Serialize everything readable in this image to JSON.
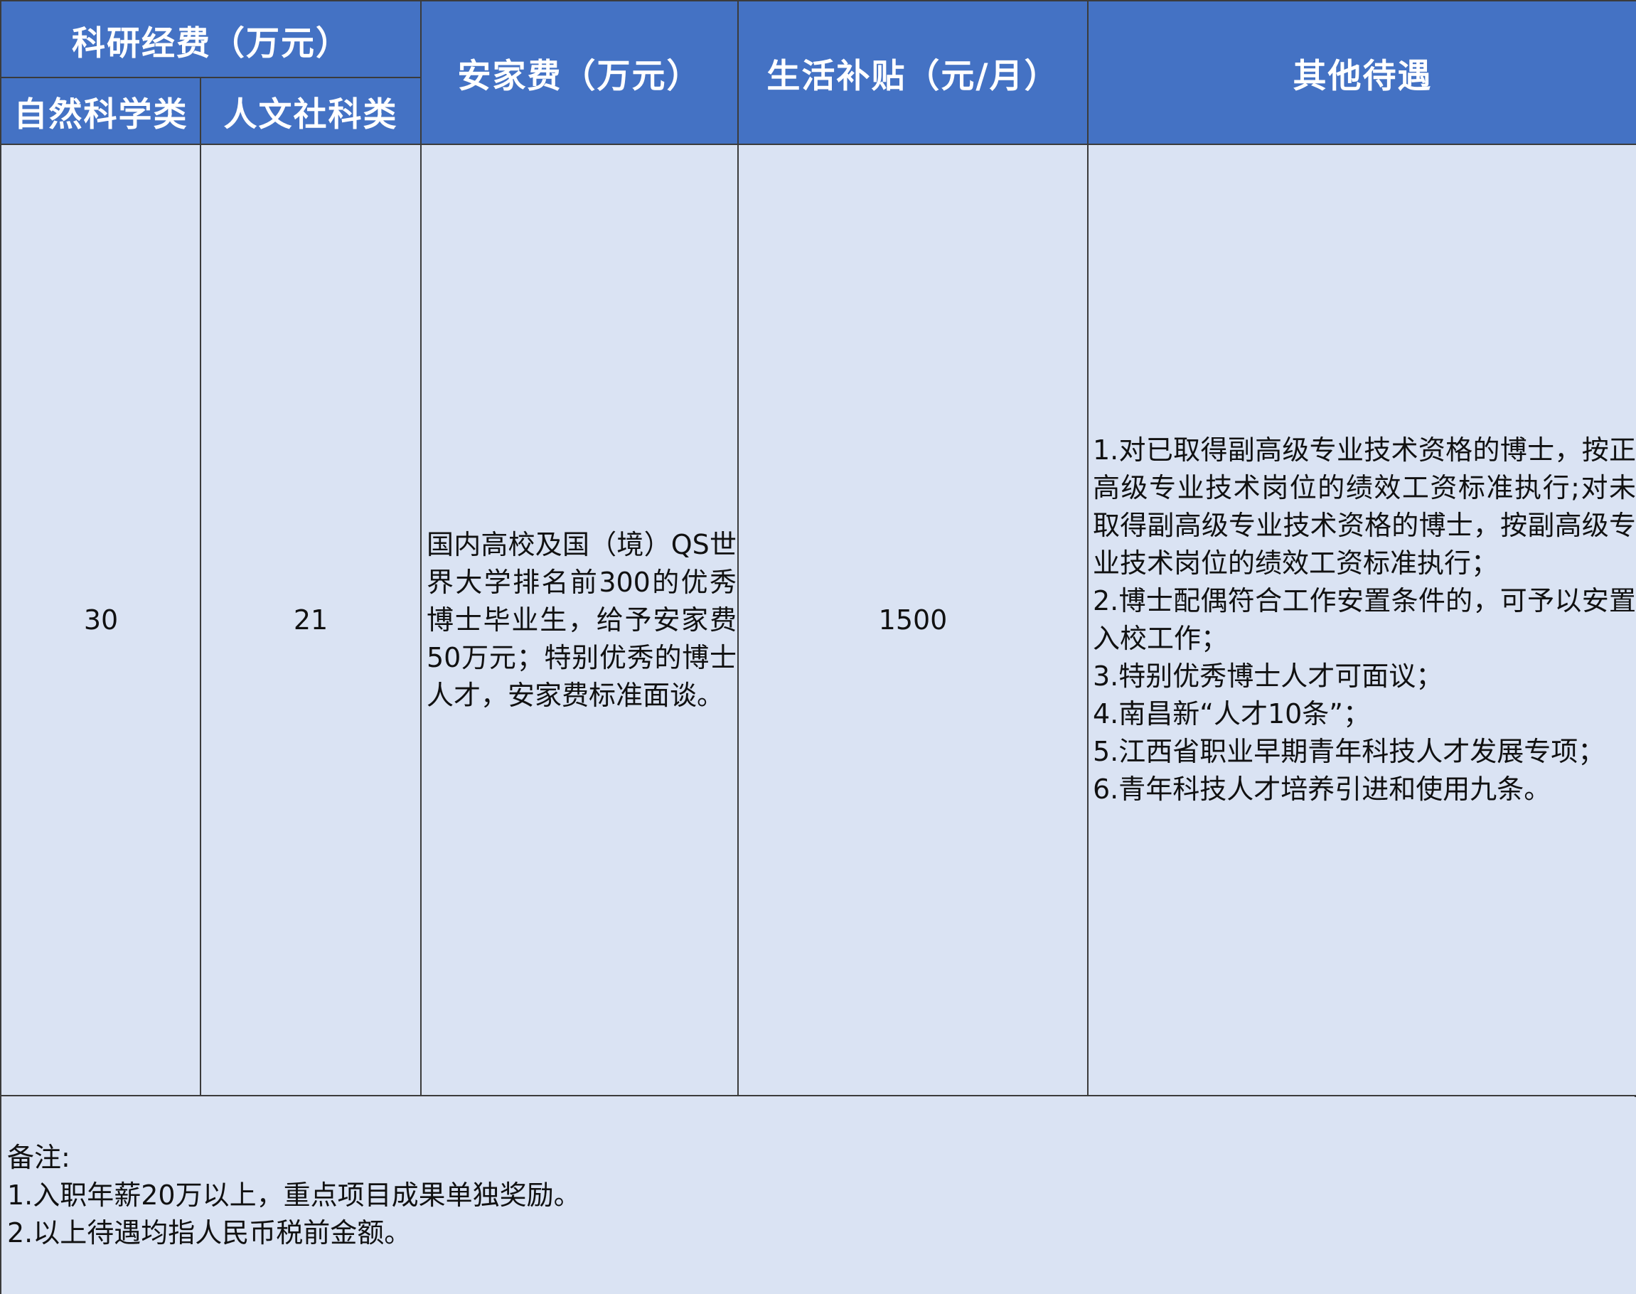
{
  "table": {
    "headers": {
      "research_fund": "科研经费（万元）",
      "natural_science": "自然科学类",
      "humanities_social": "人文社科类",
      "settlement_fee": "安家费（万元）",
      "living_allowance": "生活补贴（元/月）",
      "other_benefits": "其他待遇"
    },
    "row": {
      "natural_science": "30",
      "humanities_social": "21",
      "settlement_fee": "国内高校及国（境）QS世界大学排名前300的优秀博士毕业生，给予安家费50万元；特别优秀的博士人才，安家费标准面谈。",
      "living_allowance": "1500",
      "other_benefits": [
        "1.对已取得副高级专业技术资格的博士，按正高级专业技术岗位的绩效工资标准执行;对未取得副高级专业技术资格的博士，按副高级专业技术岗位的绩效工资标准执行；",
        "2.博士配偶符合工作安置条件的，可予以安置入校工作；",
        "3.特别优秀博士人才可面议；",
        "4.南昌新“人才10条”；",
        "5.江西省职业早期青年科技人才发展专项；",
        "6.青年科技人才培养引进和使用九条。"
      ]
    },
    "notes": {
      "title": "备注:",
      "items": [
        "1.入职年薪20万以上，重点项目成果单独奖励。",
        "2.以上待遇均指人民币税前金额。"
      ]
    }
  },
  "colors": {
    "header_bg": "#4472c4",
    "body_bg": "#dae3f3",
    "border": "#3b3b3b"
  }
}
